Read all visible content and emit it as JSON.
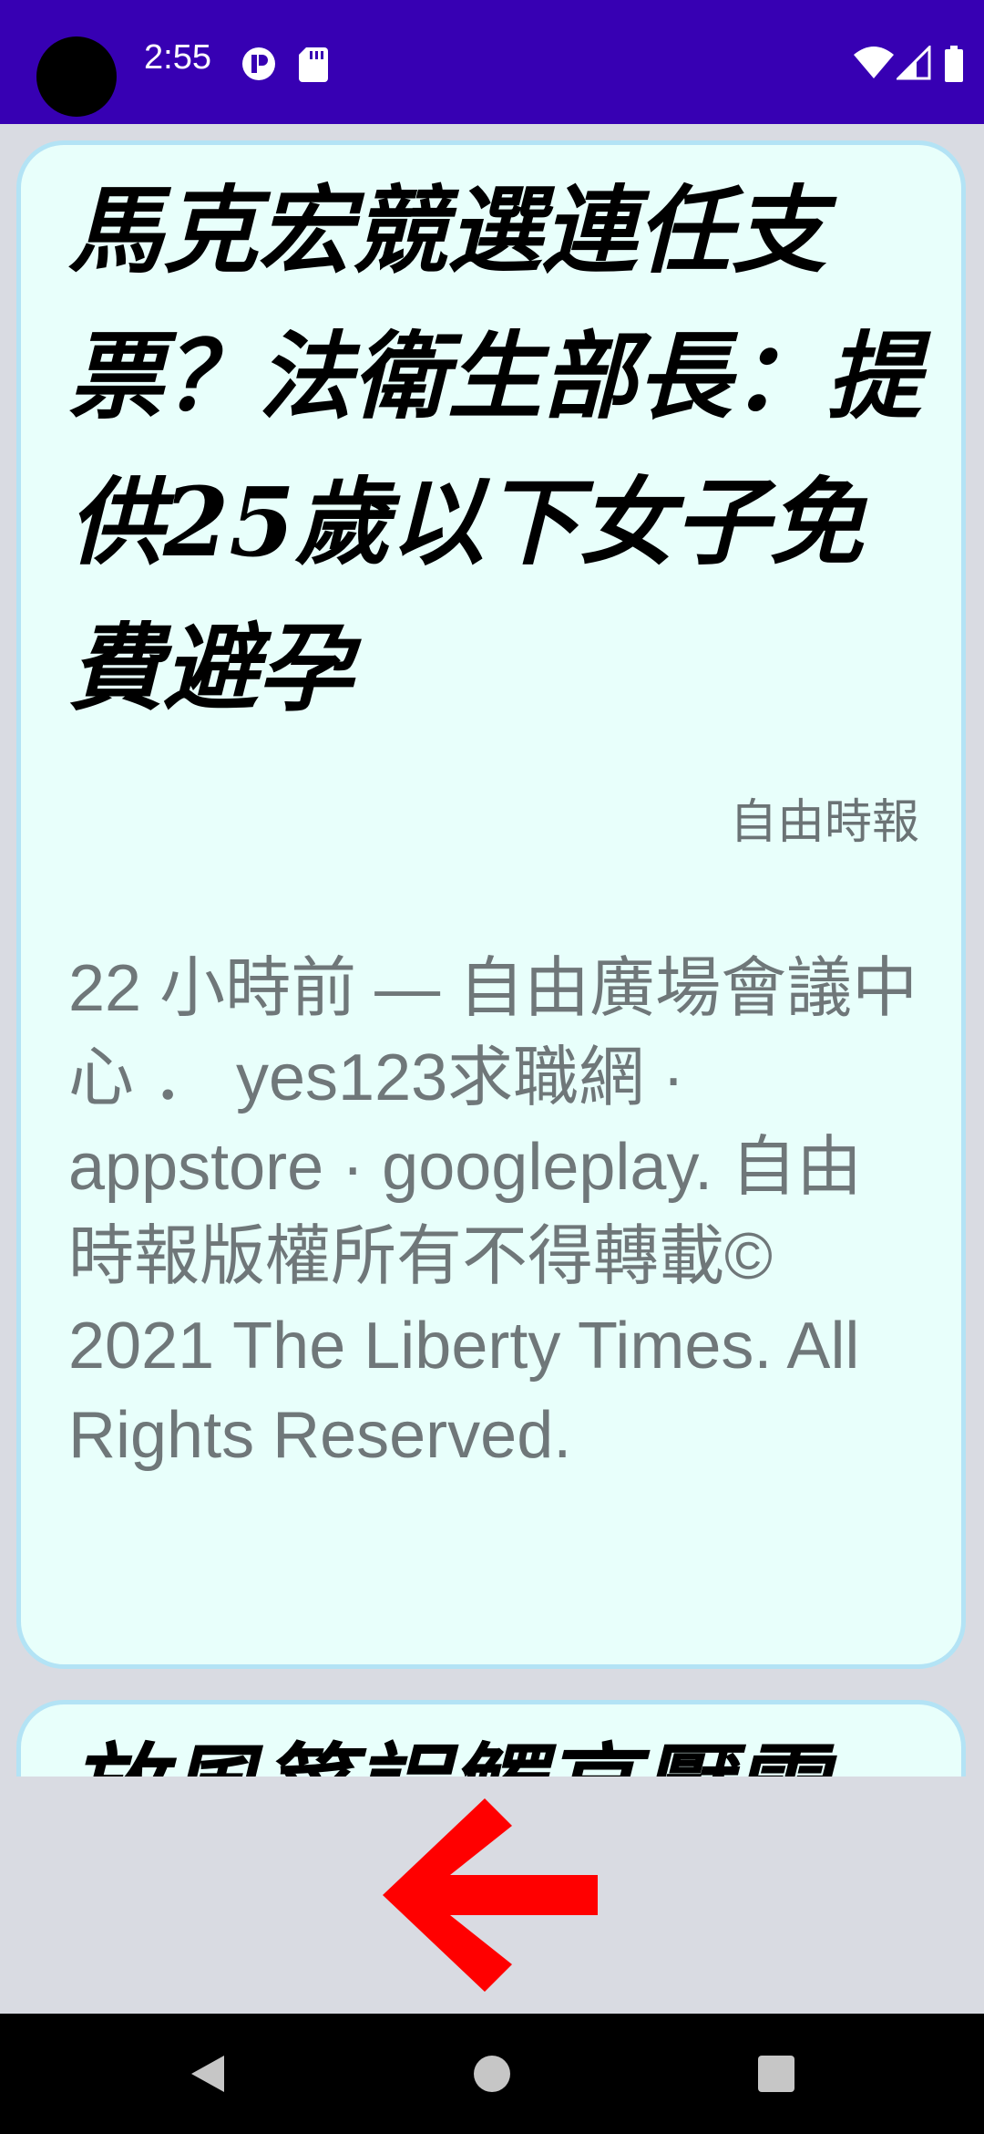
{
  "status_bar": {
    "time": "2:55",
    "background": "#3700b3",
    "left_icons": [
      "notification-icon",
      "sd-card-icon"
    ],
    "right_icons": [
      "wifi-icon",
      "cell-signal-icon",
      "battery-icon"
    ]
  },
  "feed": {
    "cards": [
      {
        "headline": "馬克宏競選連任支票？法衛生部長：提供25歲以下女子免費避孕",
        "source": "自由時報",
        "snippet": "22 小時前 — 自由廣場會議中心 ． yes123求職網 · appstore · googleplay. 自由時報版權所有不得轉載© 2021 The Liberty Times. All Rights Reserved."
      },
      {
        "headline": "放風箏誤觸高壓電"
      }
    ],
    "card_background": "#e8fffb",
    "card_border": "#b3e3f5"
  },
  "back_control": {
    "icon": "back-arrow-icon",
    "color": "#ff0000"
  },
  "nav_bar": {
    "buttons": [
      "back-triangle-icon",
      "home-circle-icon",
      "recents-square-icon"
    ]
  }
}
